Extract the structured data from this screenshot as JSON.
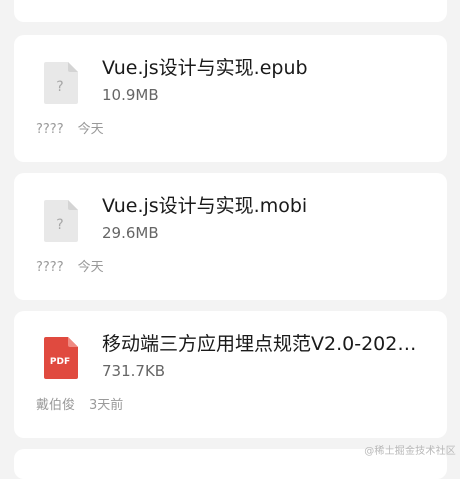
{
  "files": [
    {
      "name": "Vue.js设计与实现.epub",
      "size": "10.9MB",
      "sender": "????",
      "time": "今天",
      "icon": "unknown-file-icon"
    },
    {
      "name": "Vue.js设计与实现.mobi",
      "size": "29.6MB",
      "sender": "????",
      "time": "今天",
      "icon": "unknown-file-icon"
    },
    {
      "name": "移动端三方应用埋点规范V2.0-202…",
      "size": "731.7KB",
      "sender": "戴伯俊",
      "time": "3天前",
      "icon": "pdf-file-icon",
      "icon_label": "PDF"
    }
  ],
  "watermark": "@稀土掘金技术社区",
  "colors": {
    "background": "#f3f3f3",
    "card": "#ffffff",
    "pdf_red": "#e04a3f",
    "unknown_icon": "#e6e6e6"
  }
}
